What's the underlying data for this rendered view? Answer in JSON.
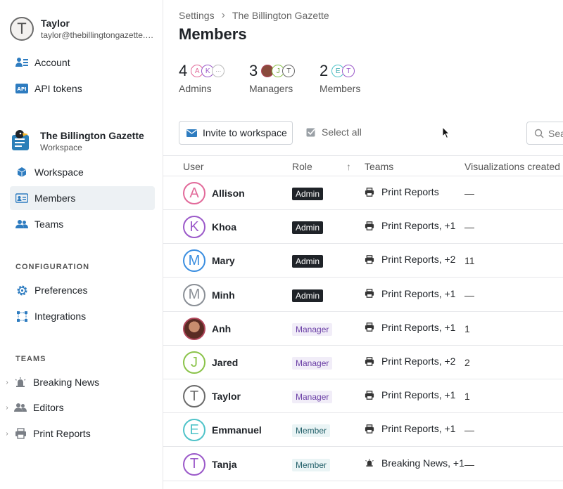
{
  "user": {
    "initial": "T",
    "name": "Taylor",
    "email": "taylor@thebillingtongazette.com"
  },
  "account_nav": [
    {
      "label": "Account",
      "icon": "account-icon"
    },
    {
      "label": "API tokens",
      "icon": "api-icon"
    }
  ],
  "workspace": {
    "name": "The Billington Gazette",
    "subtitle": "Workspace"
  },
  "workspace_nav": [
    {
      "label": "Workspace",
      "icon": "cube-icon"
    },
    {
      "label": "Members",
      "icon": "id-card-icon",
      "active": true
    },
    {
      "label": "Teams",
      "icon": "people-icon"
    }
  ],
  "configuration": {
    "title": "CONFIGURATION",
    "items": [
      {
        "label": "Preferences",
        "icon": "gear-icon"
      },
      {
        "label": "Integrations",
        "icon": "integrations-icon"
      }
    ]
  },
  "teams_section": {
    "title": "TEAMS",
    "items": [
      {
        "label": "Breaking News",
        "icon": "siren-icon"
      },
      {
        "label": "Editors",
        "icon": "people-icon"
      },
      {
        "label": "Print Reports",
        "icon": "printer-icon"
      }
    ]
  },
  "breadcrumb": {
    "root": "Settings",
    "sep": "›",
    "current": "The Billington Gazette"
  },
  "page_title": "Members",
  "stats": [
    {
      "count": "4",
      "label": "Admins",
      "avatars": [
        "A",
        "K",
        "···"
      ]
    },
    {
      "count": "3",
      "label": "Managers",
      "avatars": [
        "",
        "J",
        "T"
      ]
    },
    {
      "count": "2",
      "label": "Members",
      "avatars": [
        "E",
        "T"
      ]
    }
  ],
  "toolbar": {
    "invite_label": "Invite to workspace",
    "select_all_label": "Select all",
    "search_placeholder": "Sea"
  },
  "table": {
    "headers": {
      "user": "User",
      "role": "Role",
      "sort_arrow": "↑",
      "teams": "Teams",
      "viz": "Visualizations created"
    },
    "rows": [
      {
        "initial": "A",
        "name": "Allison",
        "role": "Admin",
        "role_type": "admin",
        "team": "Print Reports",
        "team_icon": "printer-icon",
        "viz": "—",
        "color": "#e26a9a"
      },
      {
        "initial": "K",
        "name": "Khoa",
        "role": "Admin",
        "role_type": "admin",
        "team": "Print Reports, +1",
        "team_icon": "printer-icon",
        "viz": "—",
        "color": "#9b59c9"
      },
      {
        "initial": "M",
        "name": "Mary",
        "role": "Admin",
        "role_type": "admin",
        "team": "Print Reports, +2",
        "team_icon": "printer-icon",
        "viz": "11",
        "color": "#3a8ee0"
      },
      {
        "initial": "M",
        "name": "Minh",
        "role": "Admin",
        "role_type": "admin",
        "team": "Print Reports, +1",
        "team_icon": "printer-icon",
        "viz": "—",
        "color": "#8a8f96"
      },
      {
        "initial": "",
        "name": "Anh",
        "role": "Manager",
        "role_type": "manager",
        "team": "Print Reports, +1",
        "team_icon": "printer-icon",
        "viz": "1",
        "color": "#b0455a",
        "photo": true
      },
      {
        "initial": "J",
        "name": "Jared",
        "role": "Manager",
        "role_type": "manager",
        "team": "Print Reports, +2",
        "team_icon": "printer-icon",
        "viz": "2",
        "color": "#8bc34a"
      },
      {
        "initial": "T",
        "name": "Taylor",
        "role": "Manager",
        "role_type": "manager",
        "team": "Print Reports, +1",
        "team_icon": "printer-icon",
        "viz": "1",
        "color": "#6b6b6b"
      },
      {
        "initial": "E",
        "name": "Emmanuel",
        "role": "Member",
        "role_type": "member",
        "team": "Print Reports, +1",
        "team_icon": "printer-icon",
        "viz": "—",
        "color": "#4fc3c9"
      },
      {
        "initial": "T",
        "name": "Tanja",
        "role": "Member",
        "role_type": "member",
        "team": "Breaking News, +1",
        "team_icon": "siren-icon",
        "viz": "—",
        "color": "#9b59c9"
      }
    ]
  },
  "colors": {
    "active_bg": "#edf1f4",
    "accent": "#1a6fb5",
    "border": "#e6e7ea"
  }
}
